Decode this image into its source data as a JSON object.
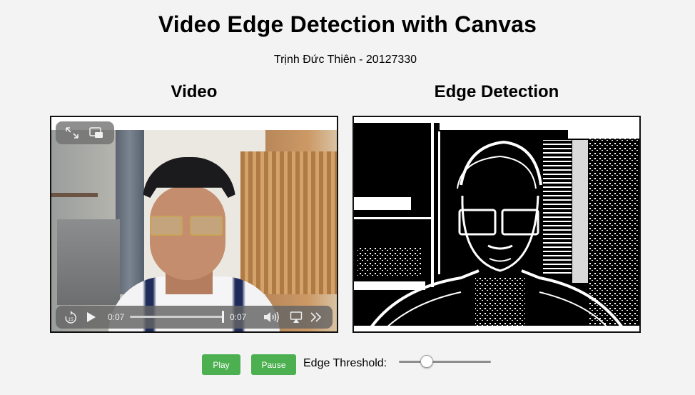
{
  "header": {
    "title": "Video Edge Detection with Canvas",
    "subtitle": "Trịnh Đức Thiên - 20127330"
  },
  "columns": {
    "video_heading": "Video",
    "edge_heading": "Edge Detection"
  },
  "video_player": {
    "current_time": "0:07",
    "total_time": "0:07",
    "progress": 1.0,
    "icons": [
      "fullscreen-icon",
      "picture-in-picture-icon",
      "rewind-15-icon",
      "play-icon",
      "volume-icon",
      "airplay-icon",
      "more-icon"
    ]
  },
  "controls": {
    "play_label": "Play",
    "pause_label": "Pause",
    "threshold_label": "Edge Threshold:",
    "threshold_fraction": 0.3
  },
  "colors": {
    "page_background": "#f3f3f3",
    "button_green": "#4caf50"
  }
}
